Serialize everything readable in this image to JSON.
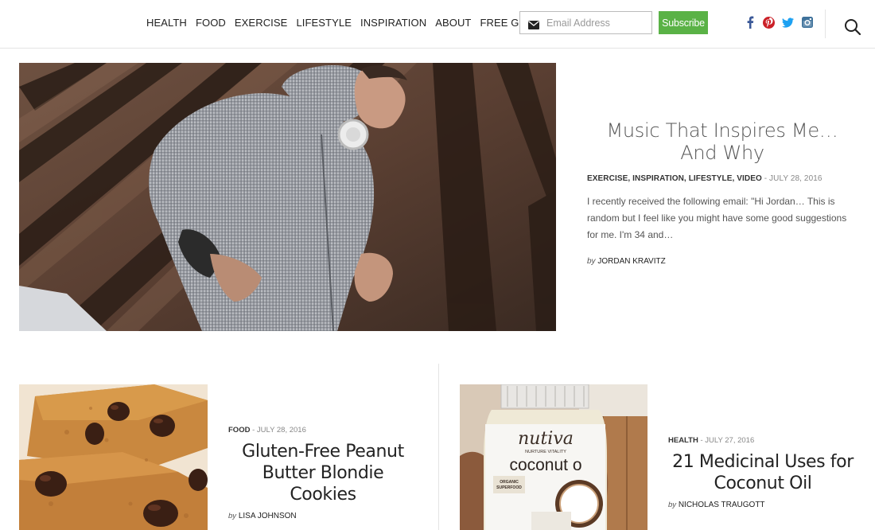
{
  "nav": {
    "items": [
      "HEALTH",
      "FOOD",
      "EXERCISE",
      "LIFESTYLE",
      "INSPIRATION",
      "ABOUT",
      "FREE GUIDE"
    ]
  },
  "subscribe_form": {
    "email_placeholder": "Email Address",
    "button_label": "Subscribe"
  },
  "social": {
    "icons": [
      "facebook-icon",
      "pinterest-icon",
      "twitter-icon",
      "instagram-icon"
    ],
    "colors": {
      "facebook": "#3b5998",
      "pinterest": "#cb2027",
      "twitter": "#1da1f2",
      "instagram": "#3f729b"
    }
  },
  "colors": {
    "accent": "#5ab246"
  },
  "hero": {
    "image_name": "running-man-hoodie-headphones",
    "title": "Music That Inspires Me… And Why",
    "categories": "EXERCISE, INSPIRATION, LIFESTYLE, VIDEO",
    "date": " - JULY 28, 2016",
    "excerpt": "I recently received the following email: \"Hi Jordan… This is random but I feel like you might have some good suggestions for me. I'm 34 and…",
    "by": "by",
    "author": "JORDAN KRAVITZ"
  },
  "cards": [
    {
      "image_name": "peanut-butter-blondie-cookies",
      "category": "FOOD",
      "date": " - JULY 28, 2016",
      "title": "Gluten-Free Peanut Butter Blondie Cookies",
      "by": "by",
      "author": "LISA JOHNSON"
    },
    {
      "image_name": "coconut-oil-jar",
      "category": "HEALTH",
      "date": " - JULY 27, 2016",
      "title": "21 Medicinal Uses for Coconut Oil",
      "by": "by",
      "author": "NICHOLAS TRAUGOTT",
      "jar_brand": "nutiva",
      "jar_tagline": "NURTURE VITALITY",
      "jar_product": "coconut o",
      "jar_badge": "ORGANIC SUPERFOOD"
    }
  ]
}
